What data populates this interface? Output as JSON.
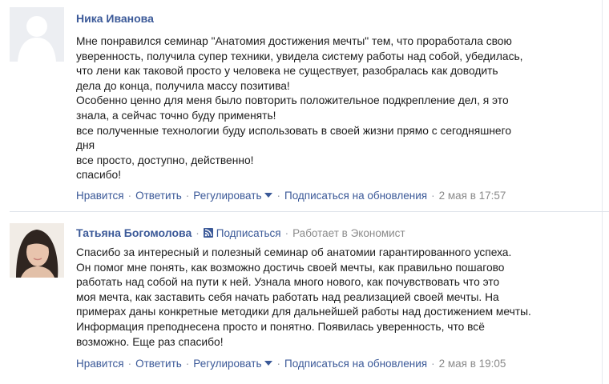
{
  "comments": [
    {
      "author": "Ника Иванова",
      "lines": [
        "Мне понравился семинар \"Анатомия достижения мечты\" тем, что проработала свою",
        "уверенность, получила супер техники, увидела систему работы над собой, убедилась,",
        "что лени как таковой просто у человека не существует, разобралась как доводить",
        "дела до конца, получила массу позитива!",
        "Особенно ценно для меня было повторить положительное подкрепление дел, я это",
        "знала, а сейчас точно буду применять!",
        "все полученные технологии буду использовать в своей жизни прямо с сегодняшнего",
        "дня",
        "все просто, доступно, действенно!",
        "спасибо!"
      ],
      "actions": {
        "like": "Нравится",
        "reply": "Ответить",
        "moderate": "Регулировать",
        "subscribe": "Подписаться на обновления",
        "time": "2 мая в 17:57"
      }
    },
    {
      "author": "Татьяна Богомолова",
      "follow": "Подписаться",
      "work": "Работает в Экономист",
      "lines": [
        "Спасибо за интересный и полезный семинар об анатомии гарантированного успеха.",
        "Он помог мне понять, как возможно достичь своей мечты, как правильно пошагово",
        "работать над собой на пути к ней. Узнала много нового, как почувствовать что это",
        "моя мечта, как заставить себя начать работать над реализацией своей мечты. На",
        "примерах даны конкретные методики для дальнейшей работы над достижением мечты.",
        "Информация преподнесена просто и понятно. Появилась уверенность, что всё",
        "возможно. Еще раз спасибо!"
      ],
      "actions": {
        "like": "Нравится",
        "reply": "Ответить",
        "moderate": "Регулировать",
        "subscribe": "Подписаться на обновления",
        "time": "2 мая в 19:05"
      }
    }
  ],
  "icons": {
    "rss": "rss-icon",
    "caret": "chevron-down-icon",
    "default_avatar": "default-avatar-icon"
  },
  "colors": {
    "link": "#3b5998",
    "meta": "#8a8a8a",
    "divider": "#dfe3ea"
  }
}
